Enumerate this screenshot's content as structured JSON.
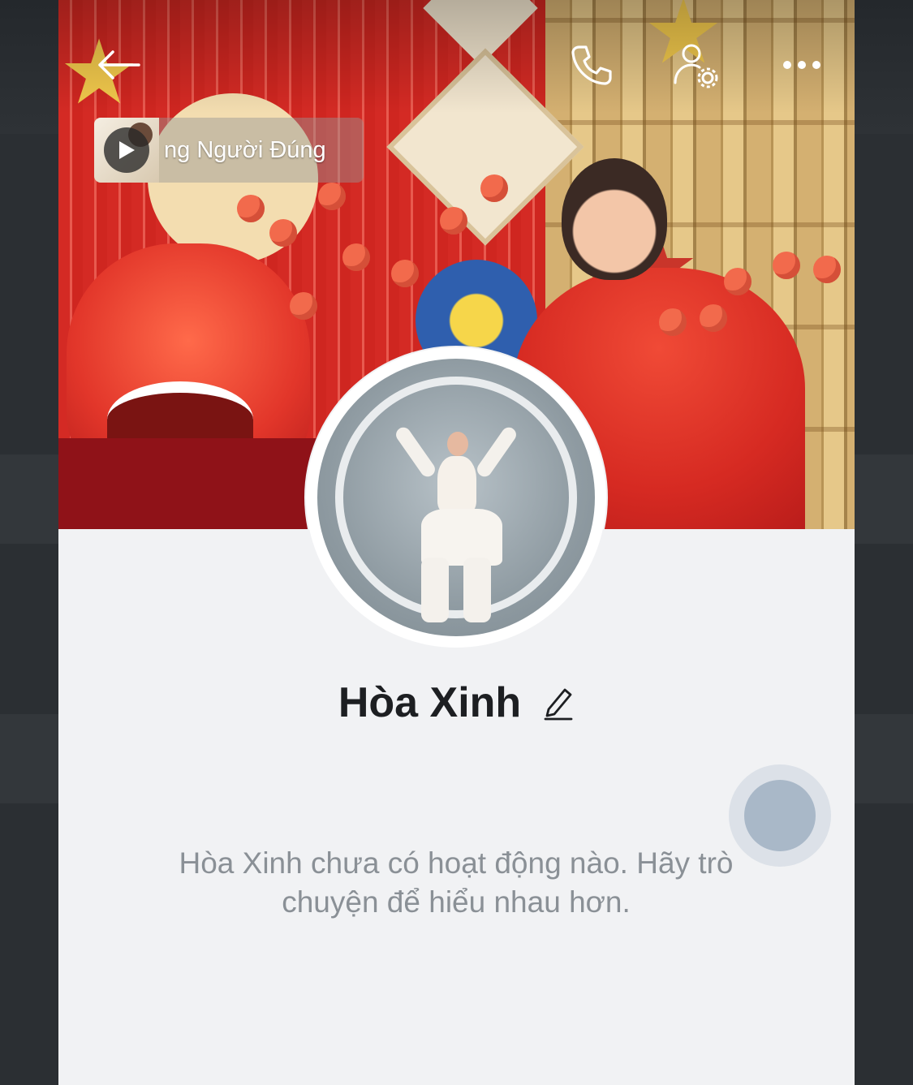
{
  "header": {
    "back_icon": "arrow-left-icon",
    "call_icon": "phone-icon",
    "profile_settings_icon": "user-gear-icon",
    "more_icon": "more-horizontal-icon"
  },
  "music": {
    "title": "ng Người Đúng"
  },
  "profile": {
    "name": "Hòa Xinh",
    "edit_icon": "pencil-icon"
  },
  "empty_state": {
    "message": "Hòa Xinh chưa có hoạt động nào. Hãy trò chuyện để hiểu nhau hơn."
  },
  "colors": {
    "page_background": "#f1f2f4",
    "name_text": "#1d1f22",
    "muted_text": "#8a9096",
    "floating_bubble": "#a9b8c8"
  }
}
